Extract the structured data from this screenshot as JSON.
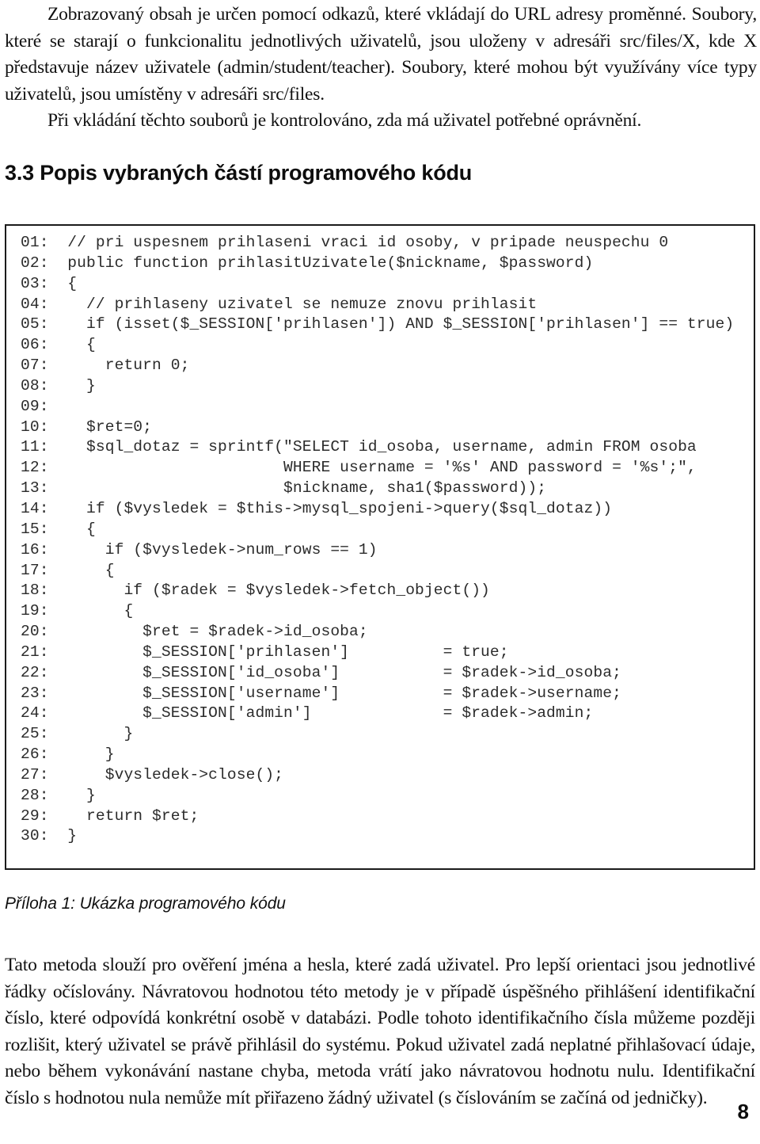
{
  "document": {
    "page_number": "8",
    "section_heading": "3.3 Popis vybraných částí programového kódu",
    "figure_caption": "Příloha 1: Ukázka programového kódu"
  },
  "intro_paragraph": {
    "text": "Zobrazovaný obsah je určen pomocí odkazů, které vkládají do URL adresy proměnné. Soubory, které se starají o funkcionalitu jednotlivých uživatelů, jsou uloženy v adresáři src/files/X, kde X představuje název uživatele (admin/student/teacher). Soubory, které mohou být využívány více typy uživatelů, jsou umístěny v adresáři src/files.",
    "second_text": "Při vkládání těchto souborů je kontrolováno, zda má uživatel potřebné oprávnění."
  },
  "code_listing": {
    "language": "php",
    "lines": [
      {
        "number": "01:",
        "code": "  // pri uspesnem prihlaseni vraci id osoby, v pripade neuspechu 0"
      },
      {
        "number": "02:",
        "code": "  public function prihlasitUzivatele($nickname, $password)"
      },
      {
        "number": "03:",
        "code": "  {"
      },
      {
        "number": "04:",
        "code": "    // prihlaseny uzivatel se nemuze znovu prihlasit"
      },
      {
        "number": "05:",
        "code": "    if (isset($_SESSION['prihlasen']) AND $_SESSION['prihlasen'] == true)"
      },
      {
        "number": "06:",
        "code": "    {"
      },
      {
        "number": "07:",
        "code": "      return 0;"
      },
      {
        "number": "08:",
        "code": "    }"
      },
      {
        "number": "09:",
        "code": ""
      },
      {
        "number": "10:",
        "code": "    $ret=0;"
      },
      {
        "number": "11:",
        "code": "    $sql_dotaz = sprintf(\"SELECT id_osoba, username, admin FROM osoba"
      },
      {
        "number": "12:",
        "code": "                         WHERE username = '%s' AND password = '%s';\","
      },
      {
        "number": "13:",
        "code": "                         $nickname, sha1($password));"
      },
      {
        "number": "14:",
        "code": "    if ($vysledek = $this->mysql_spojeni->query($sql_dotaz))"
      },
      {
        "number": "15:",
        "code": "    {"
      },
      {
        "number": "16:",
        "code": "      if ($vysledek->num_rows == 1)"
      },
      {
        "number": "17:",
        "code": "      {"
      },
      {
        "number": "18:",
        "code": "        if ($radek = $vysledek->fetch_object())"
      },
      {
        "number": "19:",
        "code": "        {"
      },
      {
        "number": "20:",
        "code": "          $ret = $radek->id_osoba;"
      },
      {
        "number": "21:",
        "code": "          $_SESSION['prihlasen']          = true;"
      },
      {
        "number": "22:",
        "code": "          $_SESSION['id_osoba']           = $radek->id_osoba;"
      },
      {
        "number": "23:",
        "code": "          $_SESSION['username']           = $radek->username;"
      },
      {
        "number": "24:",
        "code": "          $_SESSION['admin']              = $radek->admin;"
      },
      {
        "number": "25:",
        "code": "        }"
      },
      {
        "number": "26:",
        "code": "      }"
      },
      {
        "number": "27:",
        "code": "      $vysledek->close();"
      },
      {
        "number": "28:",
        "code": "    }"
      },
      {
        "number": "29:",
        "code": "    return $ret;"
      },
      {
        "number": "30:",
        "code": "  }"
      }
    ]
  },
  "closing_paragraph": {
    "text": "Tato metoda slouží pro ověření jména a hesla, které zadá uživatel. Pro lepší orientaci jsou jednotlivé řádky očíslovány. Návratovou hodnotou této metody je v případě úspěšného přihlášení identifikační číslo, které odpovídá konkrétní osobě v databázi. Podle tohoto identifikačního čísla můžeme později rozlišit, který uživatel se právě přihlásil do systému. Pokud uživatel zadá neplatné přihlašovací údaje, nebo během vykonávání nastane chyba, metoda vrátí jako návratovou hodnotu nulu. Identifikační číslo s hodnotou nula nemůže mít přiřazeno žádný uživatel (s číslováním se začíná od jedničky)."
  },
  "colors": {
    "text": "#111111",
    "code_text": "#2b2b2b",
    "code_border": "#1b1b1b",
    "page_background": "#ffffff"
  }
}
